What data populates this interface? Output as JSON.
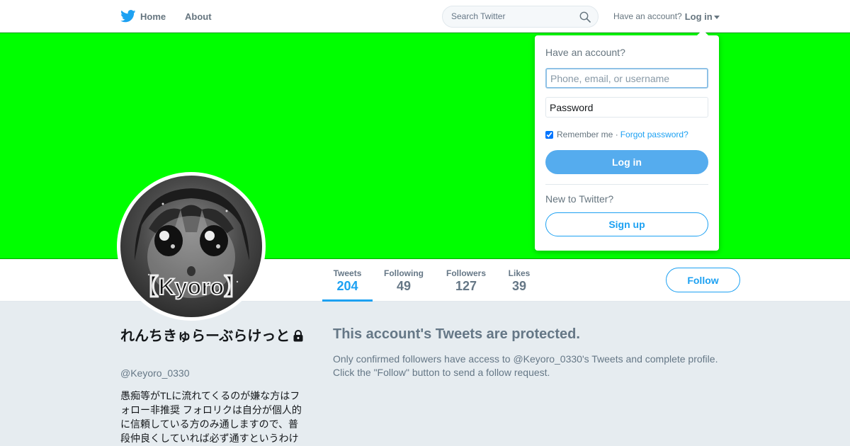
{
  "nav": {
    "home_label": "Home",
    "about_label": "About",
    "search_placeholder": "Search Twitter",
    "have_account_text": "Have an account?",
    "login_label": "Log in"
  },
  "profile": {
    "display_name": "れんちきゅらーぶらけっと",
    "handle": "@Keyoro_0330",
    "bio": "愚痴等がTLに流れてくるのが嫌な方はフォロー非推奨 フォロリクは自分が個人的に信頼している方のみ通しますので、普段仲良くしていれば必ず通すというわけ",
    "avatar_text": "【Kyoro】"
  },
  "stats": [
    {
      "label": "Tweets",
      "value": "204",
      "active": true
    },
    {
      "label": "Following",
      "value": "49",
      "active": false
    },
    {
      "label": "Followers",
      "value": "127",
      "active": false
    },
    {
      "label": "Likes",
      "value": "39",
      "active": false
    }
  ],
  "follow_label": "Follow",
  "protected": {
    "title": "This account's Tweets are protected.",
    "line1": "Only confirmed followers have access to @Keyoro_0330's Tweets and complete profile.",
    "line2": "Click the \"Follow\" button to send a follow request."
  },
  "login_dropdown": {
    "title": "Have an account?",
    "username_placeholder": "Phone, email, or username",
    "password_placeholder": "Password",
    "remember_label": "Remember me",
    "separator": "·",
    "forgot_label": "Forgot password?",
    "login_button": "Log in",
    "new_text": "New to Twitter?",
    "signup_button": "Sign up"
  },
  "colors": {
    "banner": "#00ff00",
    "accent": "#1da1f2",
    "page_bg": "#e6ecf0"
  }
}
